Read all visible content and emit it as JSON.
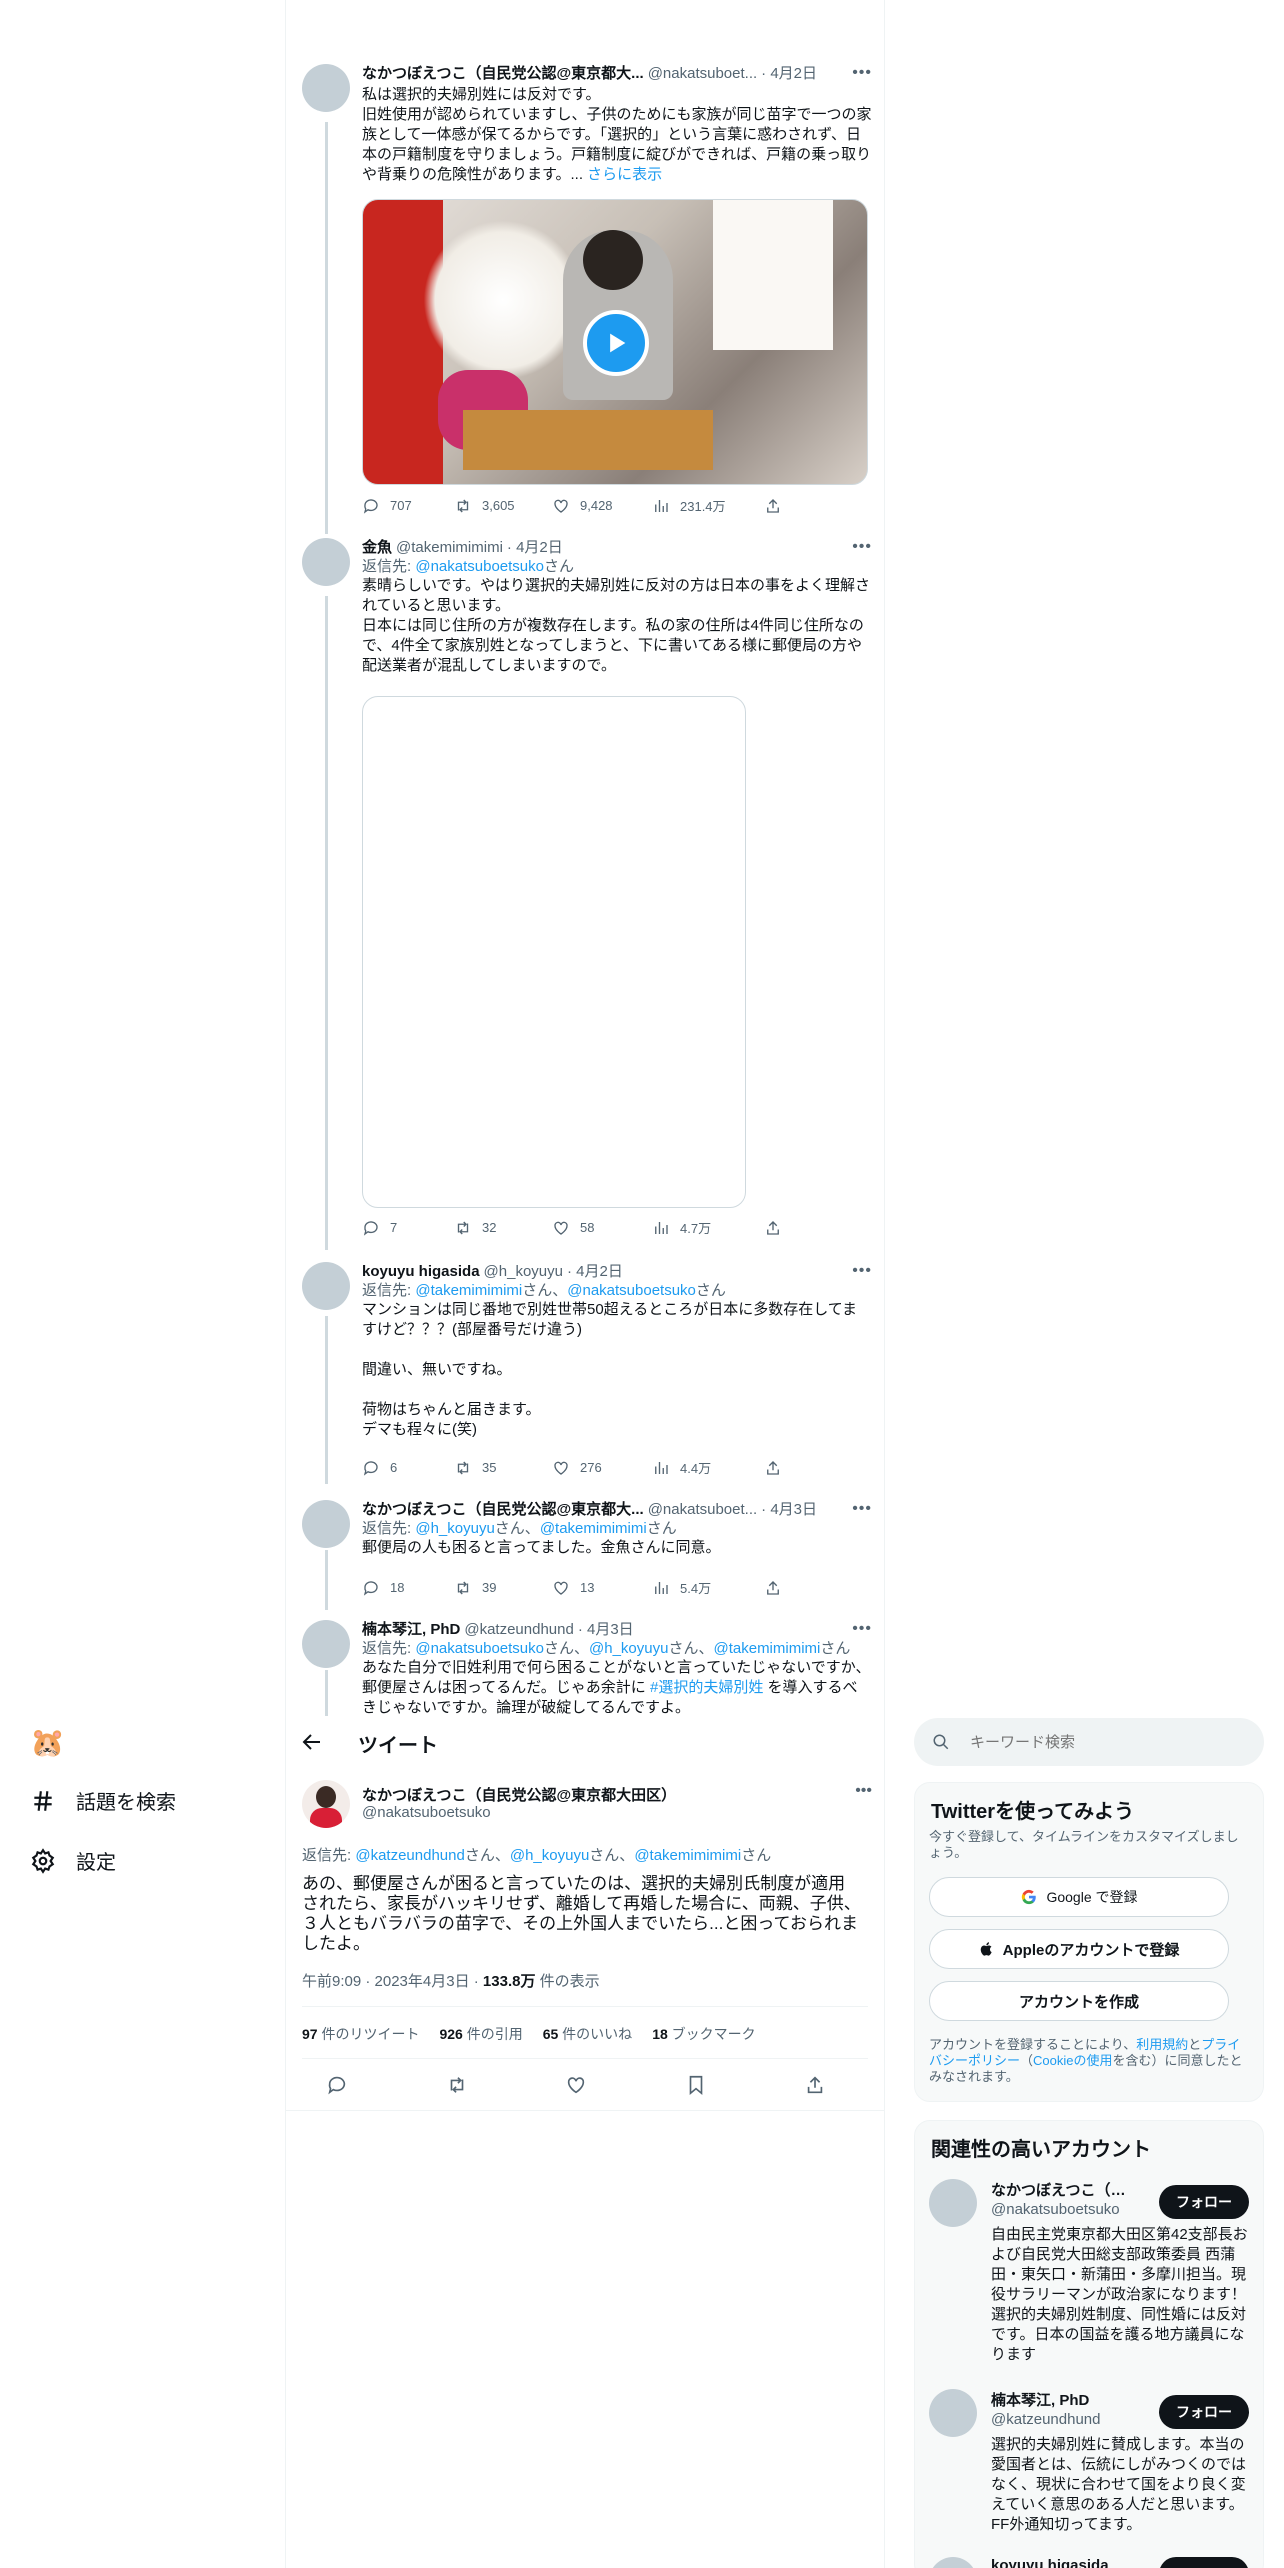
{
  "tweets": [
    {
      "name": "なかつぼえつこ（自民党公認@東京都大...",
      "handle": "@nakatsuboet...",
      "date": "· 4月2日",
      "text": "私は選択的夫婦別姓には反対です。\n旧姓使用が認められていますし、子供のためにも家族が同じ苗字で一つの家族として一体感が保てるからです。「選択的」という言葉に惑わされず、日本の戸籍制度を守りましょう。戸籍制度に綻びができれば、戸籍の乗っ取りや背乗りの危険性があります。... ",
      "more_link": "さらに表示",
      "replies": "707",
      "retweets": "3,605",
      "likes": "9,428",
      "views": "231.4万"
    },
    {
      "name": "金魚",
      "handle": "@takemimimimi",
      "date": "· 4月2日",
      "reply_prefix": "返信先: ",
      "reply_to": "@nakatsuboetsuko",
      "reply_suffix": "さん",
      "text": "素晴らしいです。やはり選択的夫婦別姓に反対の方は日本の事をよく理解されていると思います。\n日本には同じ住所の方が複数存在します。私の家の住所は4件同じ住所なので、4件全て家族別姓となってしまうと、下に書いてある様に郵便局の方や配送業者が混乱してしまいますので。",
      "replies": "7",
      "retweets": "32",
      "likes": "58",
      "views": "4.7万"
    },
    {
      "name": "koyuyu higasida",
      "handle": "@h_koyuyu",
      "date": "· 4月2日",
      "reply_prefix": "返信先: ",
      "reply_to_1": "@takemimimimi",
      "reply_mid": "さん、",
      "reply_to_2": "@nakatsuboetsuko",
      "reply_suffix": "さん",
      "text": "マンションは同じ番地で別姓世帯50超えるところが日本に多数存在してますけど？？？(部屋番号だけ違う)\n\n間違い、無いですね。\n\n荷物はちゃんと届きます。\nデマも程々に(笑)",
      "replies": "6",
      "retweets": "35",
      "likes": "276",
      "views": "4.4万"
    },
    {
      "name": "なかつぼえつこ（自民党公認@東京都大...",
      "handle": "@nakatsuboet...",
      "date": "· 4月3日",
      "reply_prefix": "返信先: ",
      "reply_to_1": "@h_koyuyu",
      "reply_mid": "さん、",
      "reply_to_2": "@takemimimimi",
      "reply_suffix": "さん",
      "text": "郵便局の人も困ると言ってました。金魚さんに同意。",
      "replies": "18",
      "retweets": "39",
      "likes": "13",
      "views": "5.4万"
    },
    {
      "name": "楠本琴江, PhD",
      "handle": "@katzeundhund",
      "date": "· 4月3日",
      "reply_prefix": "返信先: ",
      "reply_to_1": "@nakatsuboetsuko",
      "reply_mid": "さん、",
      "reply_to_2": "@h_koyuyu",
      "reply_mid2": "さん、",
      "reply_to_3": "@takemimimimi",
      "reply_suffix": "さん",
      "text_a": "あなた自分で旧姓利用で何ら困ることがないと言っていたじゃないですか、郵便屋さんは困ってるんだ。じゃあ余計に ",
      "hashtag": "#選択的夫婦別姓",
      "text_b": " を導入するべきじゃないですか。論理が破綻してるんですよ。"
    }
  ],
  "header": {
    "title": "ツイート"
  },
  "main_tweet": {
    "name": "なかつぼえつこ（自民党公認@東京都大田区）",
    "handle": "@nakatsuboetsuko",
    "reply_prefix": "返信先: ",
    "reply_to_1": "@katzeundhund",
    "reply_mid": "さん、",
    "reply_to_2": "@h_koyuyu",
    "reply_mid2": "さん、",
    "reply_to_3": "@takemimimimi",
    "reply_suffix": "さん",
    "text": "あの、郵便屋さんが困ると言っていたのは、選択的夫婦別氏制度が適用されたら、家長がハッキリせず、離婚して再婚した場合に、両親、子供、３人ともバラバラの苗字で、その上外国人までいたら...と困っておられましたよ。",
    "timestamp": "午前9:09 · 2023年4月3日 · ",
    "views_count": "133.8万",
    "views_label": " 件の表示",
    "retweets_count": "97",
    "retweets_label": " 件のリツイート",
    "quotes_count": "926",
    "quotes_label": " 件の引用",
    "likes_count": "65",
    "likes_label": " 件のいいね",
    "bookmarks_count": "18",
    "bookmarks_label": " ブックマーク"
  },
  "sidebar": {
    "logo_emoji": "🐹",
    "explore": "話題を検索",
    "settings": "設定"
  },
  "search": {
    "placeholder": "キーワード検索"
  },
  "signup": {
    "title": "Twitterを使ってみよう",
    "subtitle": "今すぐ登録して、タイムラインをカスタマイズしましょう。",
    "google": "Google で登録",
    "apple": "Appleのアカウントで登録",
    "create": "アカウントを作成",
    "legal_a": "アカウントを登録することにより、",
    "legal_terms": "利用規約",
    "legal_b": "と",
    "legal_privacy": "プライバシーポリシー",
    "legal_c": "（",
    "legal_cookie": "Cookieの使用",
    "legal_d": "を含む）に同意したとみなされます。"
  },
  "related": {
    "title": "関連性の高いアカウント",
    "follow": "フォロー",
    "accounts": [
      {
        "name": "なかつぼえつこ（自...",
        "handle": "@nakatsuboetsuko",
        "bio": "自由民主党東京都大田区第42支部長および自民党大田総支部政策委員 西蒲田・東矢口・新蒲田・多摩川担当。現役サラリーマンが政治家になります！選択的夫婦別姓制度、同性婚には反対です。日本の国益を護る地方議員になります"
      },
      {
        "name": "楠本琴江, PhD",
        "handle": "@katzeundhund",
        "bio": "選択的夫婦別姓に賛成します。本当の愛国者とは、伝統にしがみつくのではなく、現状に合わせて国をより良く変えていく意思のある人だと思います。FF外通知切ってます。"
      },
      {
        "name": "koyuyu higasida",
        "handle": "",
        "bio": ""
      }
    ]
  }
}
